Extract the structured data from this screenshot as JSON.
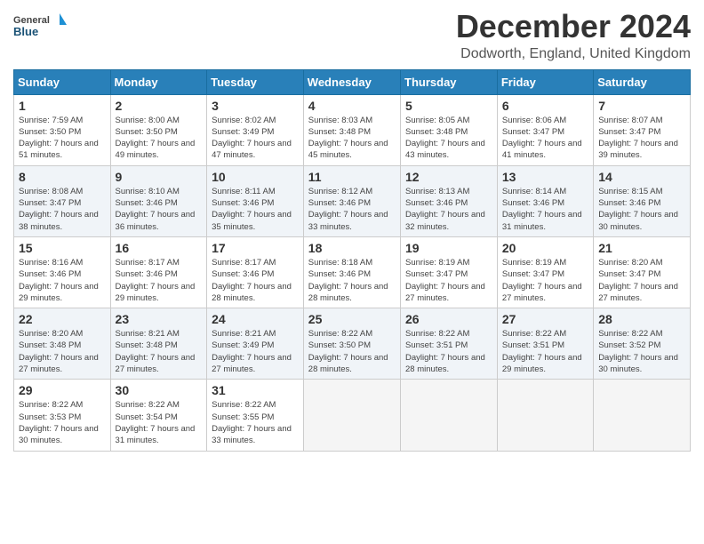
{
  "header": {
    "logo_general": "General",
    "logo_blue": "Blue",
    "month_title": "December 2024",
    "subtitle": "Dodworth, England, United Kingdom"
  },
  "weekdays": [
    "Sunday",
    "Monday",
    "Tuesday",
    "Wednesday",
    "Thursday",
    "Friday",
    "Saturday"
  ],
  "weeks": [
    [
      {
        "day": "1",
        "sunrise": "Sunrise: 7:59 AM",
        "sunset": "Sunset: 3:50 PM",
        "daylight": "Daylight: 7 hours and 51 minutes."
      },
      {
        "day": "2",
        "sunrise": "Sunrise: 8:00 AM",
        "sunset": "Sunset: 3:50 PM",
        "daylight": "Daylight: 7 hours and 49 minutes."
      },
      {
        "day": "3",
        "sunrise": "Sunrise: 8:02 AM",
        "sunset": "Sunset: 3:49 PM",
        "daylight": "Daylight: 7 hours and 47 minutes."
      },
      {
        "day": "4",
        "sunrise": "Sunrise: 8:03 AM",
        "sunset": "Sunset: 3:48 PM",
        "daylight": "Daylight: 7 hours and 45 minutes."
      },
      {
        "day": "5",
        "sunrise": "Sunrise: 8:05 AM",
        "sunset": "Sunset: 3:48 PM",
        "daylight": "Daylight: 7 hours and 43 minutes."
      },
      {
        "day": "6",
        "sunrise": "Sunrise: 8:06 AM",
        "sunset": "Sunset: 3:47 PM",
        "daylight": "Daylight: 7 hours and 41 minutes."
      },
      {
        "day": "7",
        "sunrise": "Sunrise: 8:07 AM",
        "sunset": "Sunset: 3:47 PM",
        "daylight": "Daylight: 7 hours and 39 minutes."
      }
    ],
    [
      {
        "day": "8",
        "sunrise": "Sunrise: 8:08 AM",
        "sunset": "Sunset: 3:47 PM",
        "daylight": "Daylight: 7 hours and 38 minutes."
      },
      {
        "day": "9",
        "sunrise": "Sunrise: 8:10 AM",
        "sunset": "Sunset: 3:46 PM",
        "daylight": "Daylight: 7 hours and 36 minutes."
      },
      {
        "day": "10",
        "sunrise": "Sunrise: 8:11 AM",
        "sunset": "Sunset: 3:46 PM",
        "daylight": "Daylight: 7 hours and 35 minutes."
      },
      {
        "day": "11",
        "sunrise": "Sunrise: 8:12 AM",
        "sunset": "Sunset: 3:46 PM",
        "daylight": "Daylight: 7 hours and 33 minutes."
      },
      {
        "day": "12",
        "sunrise": "Sunrise: 8:13 AM",
        "sunset": "Sunset: 3:46 PM",
        "daylight": "Daylight: 7 hours and 32 minutes."
      },
      {
        "day": "13",
        "sunrise": "Sunrise: 8:14 AM",
        "sunset": "Sunset: 3:46 PM",
        "daylight": "Daylight: 7 hours and 31 minutes."
      },
      {
        "day": "14",
        "sunrise": "Sunrise: 8:15 AM",
        "sunset": "Sunset: 3:46 PM",
        "daylight": "Daylight: 7 hours and 30 minutes."
      }
    ],
    [
      {
        "day": "15",
        "sunrise": "Sunrise: 8:16 AM",
        "sunset": "Sunset: 3:46 PM",
        "daylight": "Daylight: 7 hours and 29 minutes."
      },
      {
        "day": "16",
        "sunrise": "Sunrise: 8:17 AM",
        "sunset": "Sunset: 3:46 PM",
        "daylight": "Daylight: 7 hours and 29 minutes."
      },
      {
        "day": "17",
        "sunrise": "Sunrise: 8:17 AM",
        "sunset": "Sunset: 3:46 PM",
        "daylight": "Daylight: 7 hours and 28 minutes."
      },
      {
        "day": "18",
        "sunrise": "Sunrise: 8:18 AM",
        "sunset": "Sunset: 3:46 PM",
        "daylight": "Daylight: 7 hours and 28 minutes."
      },
      {
        "day": "19",
        "sunrise": "Sunrise: 8:19 AM",
        "sunset": "Sunset: 3:47 PM",
        "daylight": "Daylight: 7 hours and 27 minutes."
      },
      {
        "day": "20",
        "sunrise": "Sunrise: 8:19 AM",
        "sunset": "Sunset: 3:47 PM",
        "daylight": "Daylight: 7 hours and 27 minutes."
      },
      {
        "day": "21",
        "sunrise": "Sunrise: 8:20 AM",
        "sunset": "Sunset: 3:47 PM",
        "daylight": "Daylight: 7 hours and 27 minutes."
      }
    ],
    [
      {
        "day": "22",
        "sunrise": "Sunrise: 8:20 AM",
        "sunset": "Sunset: 3:48 PM",
        "daylight": "Daylight: 7 hours and 27 minutes."
      },
      {
        "day": "23",
        "sunrise": "Sunrise: 8:21 AM",
        "sunset": "Sunset: 3:48 PM",
        "daylight": "Daylight: 7 hours and 27 minutes."
      },
      {
        "day": "24",
        "sunrise": "Sunrise: 8:21 AM",
        "sunset": "Sunset: 3:49 PM",
        "daylight": "Daylight: 7 hours and 27 minutes."
      },
      {
        "day": "25",
        "sunrise": "Sunrise: 8:22 AM",
        "sunset": "Sunset: 3:50 PM",
        "daylight": "Daylight: 7 hours and 28 minutes."
      },
      {
        "day": "26",
        "sunrise": "Sunrise: 8:22 AM",
        "sunset": "Sunset: 3:51 PM",
        "daylight": "Daylight: 7 hours and 28 minutes."
      },
      {
        "day": "27",
        "sunrise": "Sunrise: 8:22 AM",
        "sunset": "Sunset: 3:51 PM",
        "daylight": "Daylight: 7 hours and 29 minutes."
      },
      {
        "day": "28",
        "sunrise": "Sunrise: 8:22 AM",
        "sunset": "Sunset: 3:52 PM",
        "daylight": "Daylight: 7 hours and 30 minutes."
      }
    ],
    [
      {
        "day": "29",
        "sunrise": "Sunrise: 8:22 AM",
        "sunset": "Sunset: 3:53 PM",
        "daylight": "Daylight: 7 hours and 30 minutes."
      },
      {
        "day": "30",
        "sunrise": "Sunrise: 8:22 AM",
        "sunset": "Sunset: 3:54 PM",
        "daylight": "Daylight: 7 hours and 31 minutes."
      },
      {
        "day": "31",
        "sunrise": "Sunrise: 8:22 AM",
        "sunset": "Sunset: 3:55 PM",
        "daylight": "Daylight: 7 hours and 33 minutes."
      },
      null,
      null,
      null,
      null
    ]
  ]
}
